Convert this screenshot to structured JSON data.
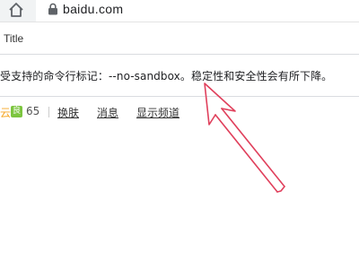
{
  "browser": {
    "url": "baidu.com",
    "bookmark_title": "Title"
  },
  "infobar": {
    "message": "受支持的命令行标记：--no-sandbox。稳定性和安全性会有所下降。"
  },
  "page_nav": {
    "weather_fragment": "云",
    "aqi_label": "良",
    "aqi_value": "65",
    "links": [
      "换肤",
      "消息",
      "显示频道"
    ]
  },
  "colors": {
    "arrow": "#e0405c",
    "aqi_badge": "#7cc53f"
  }
}
